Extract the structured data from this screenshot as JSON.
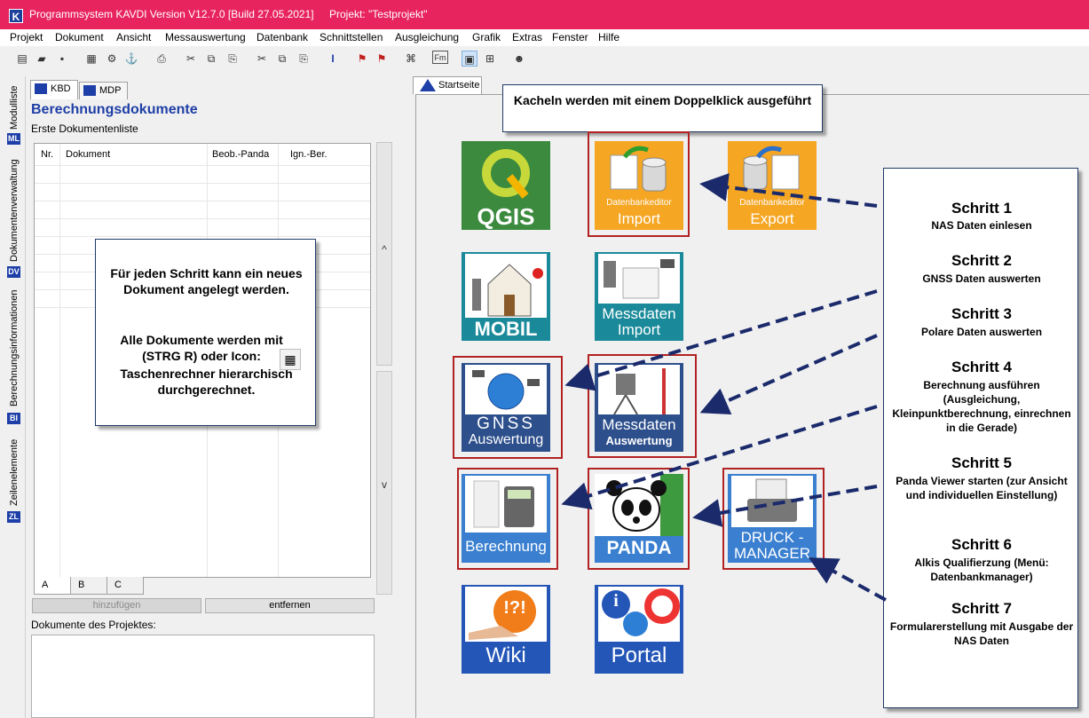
{
  "titlebar": {
    "app_title": "Programmsystem KAVDI Version V12.7.0 [Build 27.05.2021]",
    "project": "Projekt: \"Testprojekt\"",
    "app_icon_letter": "K"
  },
  "menu": [
    "Projekt",
    "Dokument",
    "Ansicht",
    "Messauswertung",
    "Datenbank",
    "Schnittstellen",
    "Ausgleichung",
    "Grafik",
    "Extras",
    "Fenster",
    "Hilfe"
  ],
  "toolbar_icons": [
    "new-doc-icon",
    "open-folder-icon",
    "save-icon",
    "calculator-icon",
    "tool-icon",
    "survey-icon",
    "print-icon",
    "cut-icon",
    "copy-icon",
    "paste-icon",
    "cut2-icon",
    "copy2-icon",
    "paste2-icon",
    "text-cursor-icon",
    "flag-icon",
    "flag2-icon",
    "binoculars-icon",
    "fm-icon",
    "layout-icon",
    "tree-icon",
    "help-icon"
  ],
  "toolbar_glyphs": [
    "▤",
    "▰",
    "▪",
    "▦",
    "⚙",
    "⚓",
    "⎙",
    "✂",
    "⧉",
    "⎘",
    "✂",
    "⧉",
    "⎘",
    "I",
    "⚑",
    "⚑",
    "⌘",
    "Fm",
    "▣",
    "⊞",
    "☻"
  ],
  "vtabs": [
    {
      "label": "Modulliste",
      "badge": "ML"
    },
    {
      "label": "Dokumentenverwaltung",
      "badge": "DV"
    },
    {
      "label": "Berechnungsinformationen",
      "badge": "BI"
    },
    {
      "label": "Zeilenelemente",
      "badge": "ZL"
    }
  ],
  "left": {
    "tabs": [
      "KBD",
      "MDP"
    ],
    "title": "Berechnungsdokumente",
    "subtitle": "Erste Dokumentenliste",
    "columns": [
      "Nr.",
      "Dokument",
      "Beob.-Panda",
      "Ign.-Ber."
    ],
    "scroll_up": "^",
    "scroll_down": "v",
    "bottom_tabs": [
      "A",
      "B",
      "C"
    ],
    "add_button": "hinzufügen",
    "remove_button": "entfernen",
    "project_docs_label": "Dokumente des Projektes:"
  },
  "infobox": {
    "line1": "Für jeden Schritt kann ein neues Dokument angelegt werden.",
    "line2": "Alle Dokumente werden mit (STRG R) oder Icon:",
    "line3": "Taschenrechner hierarchisch durchgerechnet."
  },
  "start_tab": "Startseite",
  "kachel_note": "Kacheln werden mit einem Doppelklick ausgeführt",
  "tiles": {
    "qgis": "QGIS",
    "db_import_small": "Datenbankeditor",
    "db_import": "Import",
    "db_export_small": "Datenbankeditor",
    "db_export": "Export",
    "mobil": "MOBIL",
    "mess_import1": "Messdaten",
    "mess_import2": "Import",
    "gnss1": "GNSS",
    "gnss2": "Auswertung",
    "mess_ausw1": "Messdaten",
    "mess_ausw2": "Auswertung",
    "berechnung": "Berechnung",
    "panda": "PANDA",
    "druck1": "DRUCK -",
    "druck2": "MANAGER",
    "wiki": "Wiki",
    "wiki_mark": "!?!",
    "portal": "Portal",
    "portal_mark": "i"
  },
  "steps": [
    {
      "title": "Schritt 1",
      "desc": "NAS Daten einlesen"
    },
    {
      "title": "Schritt 2",
      "desc": "GNSS Daten auswerten"
    },
    {
      "title": "Schritt 3",
      "desc": "Polare Daten auswerten"
    },
    {
      "title": "Schritt 4",
      "desc": "Berechnung ausführen (Ausgleichung, Kleinpunktberechnung, einrechnen in die Gerade)"
    },
    {
      "title": "Schritt 5",
      "desc": "Panda Viewer starten (zur Ansicht und individuellen Einstellung)"
    },
    {
      "title": "Schritt 6",
      "desc": "Alkis Qualifierzung (Menü: Datenbankmanager)"
    },
    {
      "title": "Schritt 7",
      "desc": "Formularerstellung mit Ausgabe der NAS Daten"
    }
  ],
  "colors": {
    "titlebar": "#e8245f",
    "accent_blue": "#1f3fa6",
    "tile_green": "#3b8a3e",
    "tile_orange": "#f5a623",
    "tile_teal": "#1a8a9a",
    "tile_navy": "#2d4f8c",
    "tile_lightblue": "#3a7fd0",
    "frame_red": "#b22222",
    "arrow_navy": "#1b2a6b"
  }
}
